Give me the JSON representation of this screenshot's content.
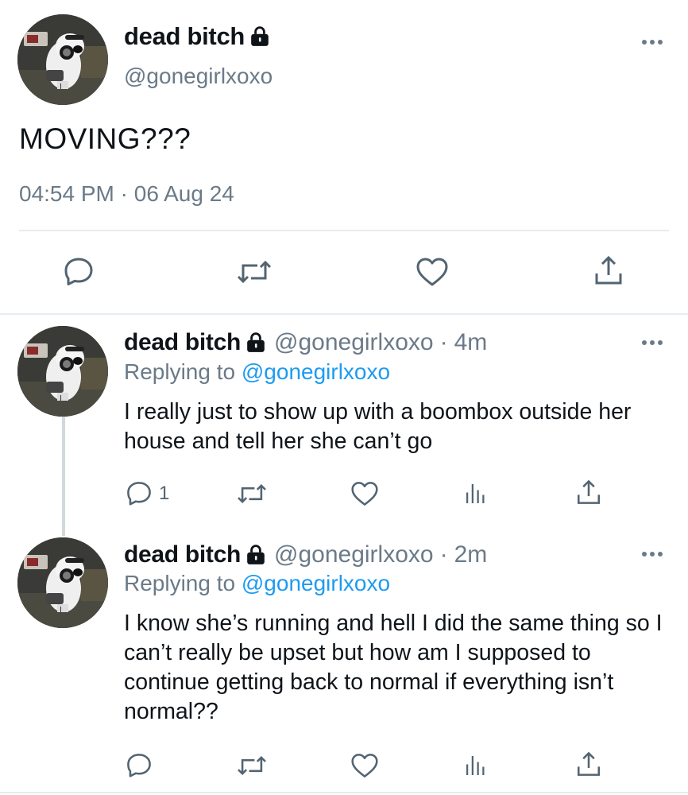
{
  "main_tweet": {
    "display_name": "dead bitch",
    "handle": "@gonegirlxoxo",
    "text": "MOVING???",
    "time": "04:54 PM",
    "separator": "·",
    "date": "06 Aug 24"
  },
  "replies": [
    {
      "display_name": "dead bitch",
      "handle": "@gonegirlxoxo",
      "separator": "·",
      "age": "4m",
      "replying_prefix": "Replying to",
      "replying_to": "@gonegirlxoxo",
      "text": "I really just to show up with a boombox outside her house and tell her she can’t go",
      "reply_count": "1"
    },
    {
      "display_name": "dead bitch",
      "handle": "@gonegirlxoxo",
      "separator": "·",
      "age": "2m",
      "replying_prefix": "Replying to",
      "replying_to": "@gonegirlxoxo",
      "text": "I know she’s running and hell I did the same thing so I can’t really be upset but how am I supposed to continue getting back to normal if everything isn’t normal??",
      "reply_count": ""
    }
  ],
  "icons": {
    "lock": "lock-icon",
    "more": "more-icon",
    "reply": "reply-icon",
    "retweet": "retweet-icon",
    "like": "heart-icon",
    "views": "views-icon",
    "share": "share-icon"
  },
  "colors": {
    "text": "#0f1419",
    "secondary": "#6b7a88",
    "mention": "#1d9bf0",
    "divider": "#e6ecf0",
    "icon": "#536471"
  }
}
